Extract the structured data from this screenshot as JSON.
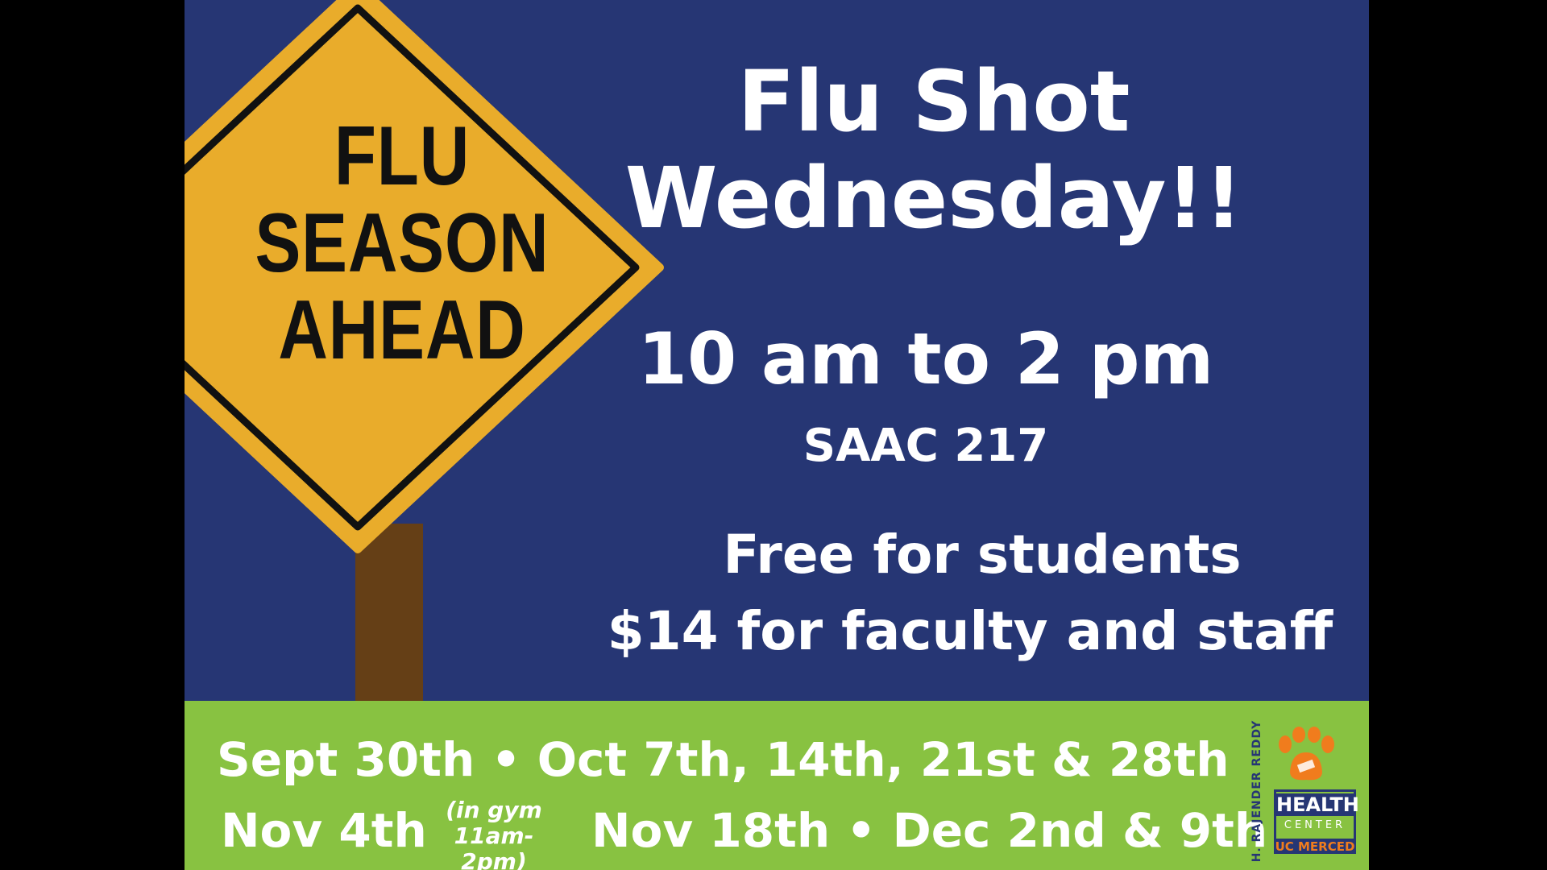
{
  "sign": {
    "line1": "FLU",
    "line2": "SEASON",
    "line3": "AHEAD"
  },
  "headline": {
    "line1": "Flu Shot",
    "line2": "Wednesday!!"
  },
  "time": "10 am to 2 pm",
  "room": "SAAC 217",
  "pricing": {
    "students": "Free for students",
    "faculty": "$14 for faculty and staff"
  },
  "dates": {
    "line1": "Sept 30th • Oct 7th, 14th, 21st & 28th",
    "line2_start": "Nov 4th",
    "gym_note_1": "(in gym",
    "gym_note_2": "11am-2pm)",
    "line2_end": "Nov 18th • Dec 2nd & 9th"
  },
  "logo": {
    "vertical_text": "H. RAJENDER REDDY",
    "health": "HEALTH",
    "center": "CENTER",
    "university": "UC MERCED"
  },
  "colors": {
    "background_blue": "#263674",
    "footer_green": "#88c241",
    "sign_yellow": "#e9ac2b",
    "post_brown": "#653f16",
    "logo_orange": "#f07c1d"
  }
}
